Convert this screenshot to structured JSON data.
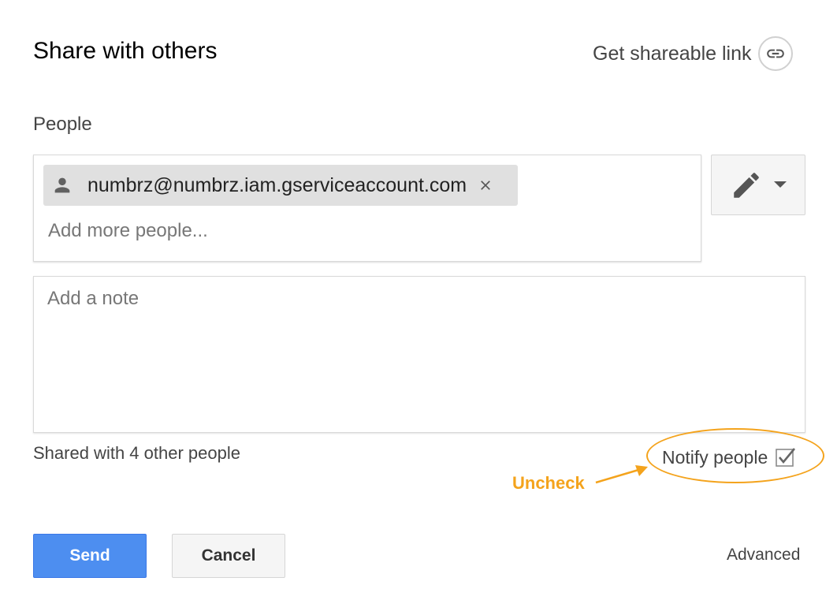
{
  "dialog": {
    "title": "Share with others",
    "shareable_link_label": "Get shareable link",
    "icons": {
      "link": "link-icon",
      "person": "person-icon",
      "chip_close": "close-icon",
      "permission": "pencil-icon",
      "dropdown": "caret-down-icon",
      "checkbox": "checkbox-checked-icon"
    }
  },
  "people": {
    "label": "People",
    "chips": [
      {
        "email": "numbrz@numbrz.iam.gserviceaccount.com"
      }
    ],
    "input_placeholder": "Add more people...",
    "input_value": ""
  },
  "note": {
    "placeholder": "Add a note",
    "value": ""
  },
  "status": {
    "shared_text": "Shared with 4 other people",
    "notify_label": "Notify people",
    "notify_checked": true
  },
  "annotation": {
    "text": "Uncheck",
    "color": "#f4a31c"
  },
  "footer": {
    "send_label": "Send",
    "cancel_label": "Cancel",
    "advanced_label": "Advanced"
  },
  "colors": {
    "primary": "#4d8ef0",
    "annotation": "#f4a31c",
    "text": "#444444"
  }
}
